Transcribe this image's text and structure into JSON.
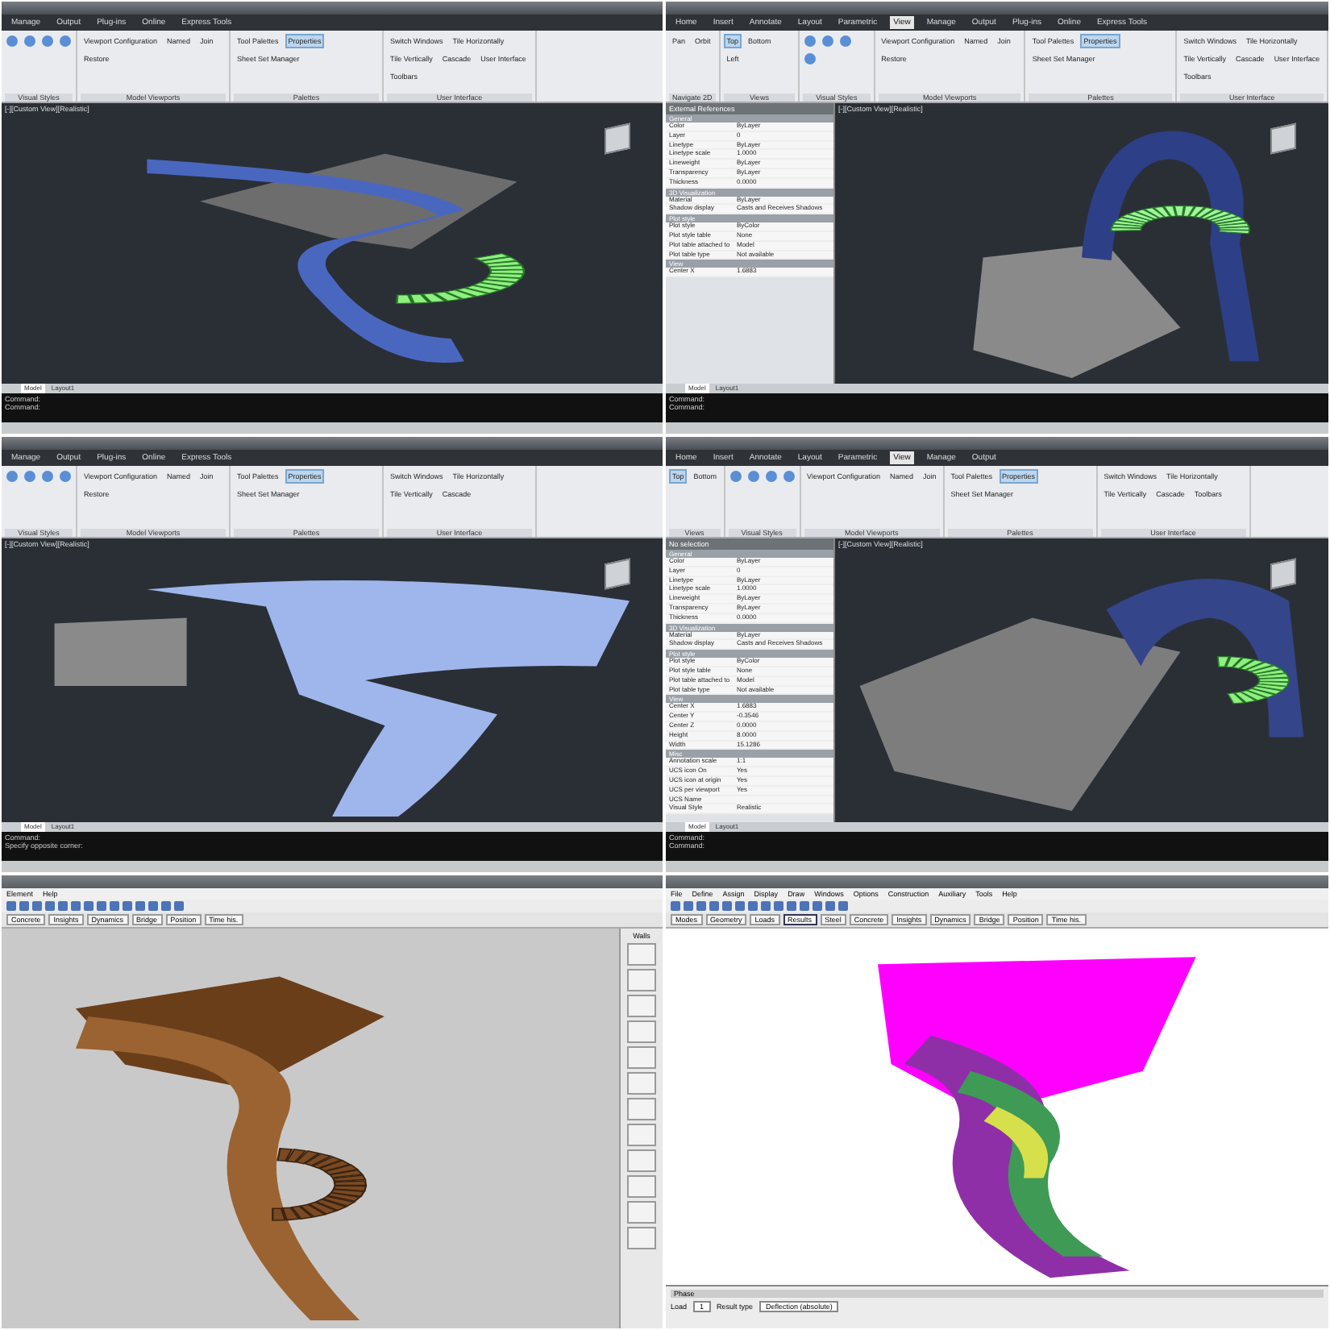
{
  "panels": [
    {
      "kind": "cad",
      "ribbon_tabs": [
        {
          "label": "Manage",
          "selected": false
        },
        {
          "label": "Output",
          "selected": false
        },
        {
          "label": "Plug-ins",
          "selected": false
        },
        {
          "label": "Online",
          "selected": false
        },
        {
          "label": "Express Tools",
          "selected": false
        }
      ],
      "groups": [
        {
          "title": "Visual Styles"
        },
        {
          "title": "Model Viewports",
          "buttons": [
            {
              "label": "Viewport Configuration",
              "selected": false
            },
            {
              "label": "Named",
              "selected": false
            },
            {
              "label": "Join",
              "selected": false
            },
            {
              "label": "Restore",
              "selected": false
            }
          ]
        },
        {
          "title": "Palettes",
          "buttons": [
            {
              "label": "Tool Palettes",
              "selected": false
            },
            {
              "label": "Properties",
              "selected": true
            },
            {
              "label": "Sheet Set Manager",
              "selected": false
            }
          ]
        },
        {
          "title": "User Interface",
          "buttons": [
            {
              "label": "Switch Windows",
              "selected": false
            },
            {
              "label": "Tile Horizontally",
              "selected": false
            },
            {
              "label": "Tile Vertically",
              "selected": false
            },
            {
              "label": "Cascade",
              "selected": false
            },
            {
              "label": "User Interface",
              "selected": false
            },
            {
              "label": "Toolbars",
              "selected": false
            }
          ]
        }
      ],
      "viewport_label": "[-][Custom View][Realistic]",
      "model": {
        "kind": "blue-top"
      },
      "layout_tabs": [
        {
          "label": "Model",
          "selected": true
        },
        {
          "label": "Layout1",
          "selected": false
        }
      ],
      "command_lines": [
        "Command:",
        "Command:"
      ]
    },
    {
      "kind": "cad",
      "ribbon_tabs": [
        {
          "label": "Home",
          "selected": false
        },
        {
          "label": "Insert",
          "selected": false
        },
        {
          "label": "Annotate",
          "selected": false
        },
        {
          "label": "Layout",
          "selected": false
        },
        {
          "label": "Parametric",
          "selected": false
        },
        {
          "label": "View",
          "selected": true
        },
        {
          "label": "Manage",
          "selected": false
        },
        {
          "label": "Output",
          "selected": false
        },
        {
          "label": "Plug-ins",
          "selected": false
        },
        {
          "label": "Online",
          "selected": false
        },
        {
          "label": "Express Tools",
          "selected": false
        }
      ],
      "groups": [
        {
          "title": "Navigate 2D",
          "buttons": [
            {
              "label": "Pan",
              "selected": false
            },
            {
              "label": "Orbit",
              "selected": false
            }
          ]
        },
        {
          "title": "Views",
          "buttons": [
            {
              "label": "Top",
              "selected": true
            },
            {
              "label": "Bottom",
              "selected": false
            },
            {
              "label": "Left",
              "selected": false
            }
          ]
        },
        {
          "title": "Visual Styles"
        },
        {
          "title": "Model Viewports",
          "buttons": [
            {
              "label": "Viewport Configuration",
              "selected": false
            },
            {
              "label": "Named",
              "selected": false
            },
            {
              "label": "Join",
              "selected": false
            },
            {
              "label": "Restore",
              "selected": false
            }
          ]
        },
        {
          "title": "Palettes",
          "buttons": [
            {
              "label": "Tool Palettes",
              "selected": false
            },
            {
              "label": "Properties",
              "selected": true
            },
            {
              "label": "Sheet Set Manager",
              "selected": false
            }
          ]
        },
        {
          "title": "User Interface",
          "buttons": [
            {
              "label": "Switch Windows",
              "selected": false
            },
            {
              "label": "Tile Horizontally",
              "selected": false
            },
            {
              "label": "Tile Vertically",
              "selected": false
            },
            {
              "label": "Cascade",
              "selected": false
            },
            {
              "label": "User Interface",
              "selected": false
            },
            {
              "label": "Toolbars",
              "selected": false
            }
          ]
        }
      ],
      "viewport_label": "[-][Custom View][Realistic]",
      "model": {
        "kind": "green-arch"
      },
      "layout_tabs": [
        {
          "label": "Model",
          "selected": true
        },
        {
          "label": "Layout1",
          "selected": false
        }
      ],
      "command_lines": [
        "Command:",
        "Command:"
      ],
      "palette": {
        "title": "External References",
        "sections": [
          {
            "title": "General",
            "rows": [
              {
                "name": "Color",
                "value": "ByLayer"
              },
              {
                "name": "Layer",
                "value": "0"
              },
              {
                "name": "Linetype",
                "value": "ByLayer"
              },
              {
                "name": "Linetype scale",
                "value": "1.0000"
              },
              {
                "name": "Lineweight",
                "value": "ByLayer"
              },
              {
                "name": "Transparency",
                "value": "ByLayer"
              },
              {
                "name": "Thickness",
                "value": "0.0000"
              }
            ]
          },
          {
            "title": "3D Visualization",
            "rows": [
              {
                "name": "Material",
                "value": "ByLayer"
              },
              {
                "name": "Shadow display",
                "value": "Casts and Receives Shadows"
              }
            ]
          },
          {
            "title": "Plot style",
            "rows": [
              {
                "name": "Plot style",
                "value": "ByColor"
              },
              {
                "name": "Plot style table",
                "value": "None"
              },
              {
                "name": "Plot table attached to",
                "value": "Model"
              },
              {
                "name": "Plot table type",
                "value": "Not available"
              }
            ]
          },
          {
            "title": "View",
            "rows": [
              {
                "name": "Center X",
                "value": "1.6883"
              }
            ]
          }
        ]
      }
    },
    {
      "kind": "cad",
      "ribbon_tabs": [
        {
          "label": "Manage",
          "selected": false
        },
        {
          "label": "Output",
          "selected": false
        },
        {
          "label": "Plug-ins",
          "selected": false
        },
        {
          "label": "Online",
          "selected": false
        },
        {
          "label": "Express Tools",
          "selected": false
        }
      ],
      "groups": [
        {
          "title": "Visual Styles"
        },
        {
          "title": "Model Viewports",
          "buttons": [
            {
              "label": "Viewport Configuration",
              "selected": false
            },
            {
              "label": "Named",
              "selected": false
            },
            {
              "label": "Join",
              "selected": false
            },
            {
              "label": "Restore",
              "selected": false
            }
          ]
        },
        {
          "title": "Palettes",
          "buttons": [
            {
              "label": "Tool Palettes",
              "selected": false
            },
            {
              "label": "Properties",
              "selected": true
            },
            {
              "label": "Sheet Set Manager",
              "selected": false
            }
          ]
        },
        {
          "title": "User Interface",
          "buttons": [
            {
              "label": "Switch Windows",
              "selected": false
            },
            {
              "label": "Tile Horizontally",
              "selected": false
            },
            {
              "label": "Tile Vertically",
              "selected": false
            },
            {
              "label": "Cascade",
              "selected": false
            }
          ]
        }
      ],
      "viewport_label": "[-][Custom View][Realistic]",
      "model": {
        "kind": "blue-side"
      },
      "layout_tabs": [
        {
          "label": "Model",
          "selected": true
        },
        {
          "label": "Layout1",
          "selected": false
        }
      ],
      "command_lines": [
        "Command:",
        "Specify opposite corner:"
      ]
    },
    {
      "kind": "cad",
      "ribbon_tabs": [
        {
          "label": "Home",
          "selected": false
        },
        {
          "label": "Insert",
          "selected": false
        },
        {
          "label": "Annotate",
          "selected": false
        },
        {
          "label": "Layout",
          "selected": false
        },
        {
          "label": "Parametric",
          "selected": false
        },
        {
          "label": "View",
          "selected": true
        },
        {
          "label": "Manage",
          "selected": false
        },
        {
          "label": "Output",
          "selected": false
        }
      ],
      "groups": [
        {
          "title": "Views",
          "buttons": [
            {
              "label": "Top",
              "selected": true
            },
            {
              "label": "Bottom",
              "selected": false
            }
          ]
        },
        {
          "title": "Visual Styles"
        },
        {
          "title": "Model Viewports",
          "buttons": [
            {
              "label": "Viewport Configuration",
              "selected": false
            },
            {
              "label": "Named",
              "selected": false
            },
            {
              "label": "Join",
              "selected": false
            }
          ]
        },
        {
          "title": "Palettes",
          "buttons": [
            {
              "label": "Tool Palettes",
              "selected": false
            },
            {
              "label": "Properties",
              "selected": true
            },
            {
              "label": "Sheet Set Manager",
              "selected": false
            }
          ]
        },
        {
          "title": "User Interface",
          "buttons": [
            {
              "label": "Switch Windows",
              "selected": false
            },
            {
              "label": "Tile Horizontally",
              "selected": false
            },
            {
              "label": "Tile Vertically",
              "selected": false
            },
            {
              "label": "Cascade",
              "selected": false
            },
            {
              "label": "Toolbars",
              "selected": false
            }
          ]
        }
      ],
      "viewport_label": "[-][Custom View][Realistic]",
      "model": {
        "kind": "green-slab"
      },
      "layout_tabs": [
        {
          "label": "Model",
          "selected": true
        },
        {
          "label": "Layout1",
          "selected": false
        }
      ],
      "command_lines": [
        "Command:",
        "Command:"
      ],
      "palette": {
        "title": "No selection",
        "sections": [
          {
            "title": "General",
            "rows": [
              {
                "name": "Color",
                "value": "ByLayer"
              },
              {
                "name": "Layer",
                "value": "0"
              },
              {
                "name": "Linetype",
                "value": "ByLayer"
              },
              {
                "name": "Linetype scale",
                "value": "1.0000"
              },
              {
                "name": "Lineweight",
                "value": "ByLayer"
              },
              {
                "name": "Transparency",
                "value": "ByLayer"
              },
              {
                "name": "Thickness",
                "value": "0.0000"
              }
            ]
          },
          {
            "title": "3D Visualization",
            "rows": [
              {
                "name": "Material",
                "value": "ByLayer"
              },
              {
                "name": "Shadow display",
                "value": "Casts and Receives Shadows"
              }
            ]
          },
          {
            "title": "Plot style",
            "rows": [
              {
                "name": "Plot style",
                "value": "ByColor"
              },
              {
                "name": "Plot style table",
                "value": "None"
              },
              {
                "name": "Plot table attached to",
                "value": "Model"
              },
              {
                "name": "Plot table type",
                "value": "Not available"
              }
            ]
          },
          {
            "title": "View",
            "rows": [
              {
                "name": "Center X",
                "value": "1.6883"
              },
              {
                "name": "Center Y",
                "value": "-0.3546"
              },
              {
                "name": "Center Z",
                "value": "0.0000"
              },
              {
                "name": "Height",
                "value": "8.0000"
              },
              {
                "name": "Width",
                "value": "15.1286"
              }
            ]
          },
          {
            "title": "Misc",
            "rows": [
              {
                "name": "Annotation scale",
                "value": "1:1"
              },
              {
                "name": "UCS icon On",
                "value": "Yes"
              },
              {
                "name": "UCS icon at origin",
                "value": "Yes"
              },
              {
                "name": "UCS per viewport",
                "value": "Yes"
              },
              {
                "name": "UCS Name"
              },
              {
                "name": "Visual Style",
                "value": "Realistic"
              }
            ]
          }
        ]
      }
    },
    {
      "kind": "fem",
      "menu": [
        "Element",
        "Help"
      ],
      "tabs": [
        {
          "label": "Concrete",
          "selected": false
        },
        {
          "label": "Insights",
          "selected": false
        },
        {
          "label": "Dynamics",
          "selected": false
        },
        {
          "label": "Bridge",
          "selected": false
        },
        {
          "label": "Position",
          "selected": false
        },
        {
          "label": "Time his.",
          "selected": false
        }
      ],
      "model": {
        "kind": "brown"
      },
      "side_title": "Walls"
    },
    {
      "kind": "fem",
      "menu": [
        "File",
        "Define",
        "Assign",
        "Display",
        "Draw",
        "Windows",
        "Options",
        "Construction",
        "Auxiliary",
        "Tools",
        "Help"
      ],
      "tabs": [
        {
          "label": "Modes",
          "selected": false
        },
        {
          "label": "Geometry",
          "selected": false
        },
        {
          "label": "Loads",
          "selected": false
        },
        {
          "label": "Results",
          "selected": true
        },
        {
          "label": "Steel",
          "selected": false
        },
        {
          "label": "Concrete",
          "selected": false
        },
        {
          "label": "Insights",
          "selected": false
        },
        {
          "label": "Dynamics",
          "selected": false
        },
        {
          "label": "Bridge",
          "selected": false
        },
        {
          "label": "Position",
          "selected": false
        },
        {
          "label": "Time his.",
          "selected": false
        }
      ],
      "model": {
        "kind": "contour"
      },
      "bottom": {
        "title": "Phase",
        "fields": [
          {
            "label": "Load",
            "value": "1"
          },
          {
            "label": "Result type",
            "value": "Deflection (absolute)"
          }
        ]
      }
    }
  ]
}
